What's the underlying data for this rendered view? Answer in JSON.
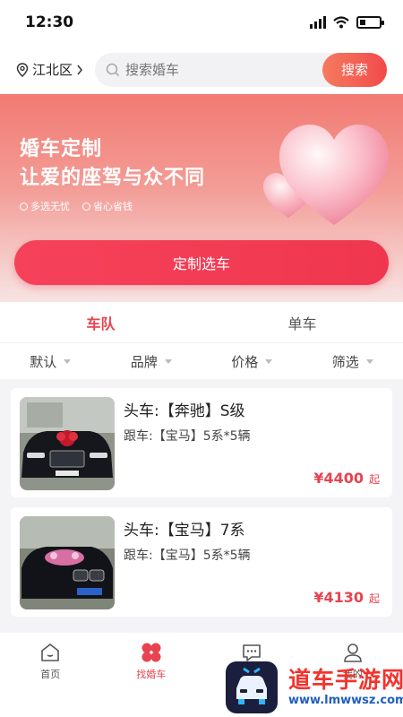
{
  "status_bar": {
    "time": "12:30"
  },
  "header": {
    "location": "江北区",
    "search_placeholder": "搜索婚车",
    "search_button": "搜索"
  },
  "banner": {
    "title_line1": "婚车定制",
    "title_line2": "让爱的座驾与众不同",
    "tags": [
      "多选无忧",
      "省心省钱"
    ],
    "cta_button": "定制选车"
  },
  "tabs": [
    {
      "label": "车队",
      "active": true
    },
    {
      "label": "单车",
      "active": false
    }
  ],
  "filters": [
    "默认",
    "品牌",
    "价格",
    "筛选"
  ],
  "cars": [
    {
      "lead": "头车:【奔驰】S级",
      "follow": "跟车:【宝马】5系*5辆",
      "price": "¥4400",
      "price_suffix": "起"
    },
    {
      "lead": "头车:【宝马】7系",
      "follow": "跟车:【宝马】5系*5辆",
      "price": "¥4130",
      "price_suffix": "起"
    }
  ],
  "bottom_nav": [
    {
      "label": "首页",
      "icon": "home-icon",
      "active": false
    },
    {
      "label": "找婚车",
      "icon": "clover-icon",
      "active": true
    },
    {
      "label": "",
      "icon": "message-icon",
      "active": false
    },
    {
      "label": "我的",
      "icon": "user-icon",
      "active": false
    }
  ],
  "watermark": {
    "title": "道车手游网",
    "url": "www.lmwwsz.com"
  },
  "colors": {
    "accent": "#e8434f",
    "button": "#f0364f",
    "banner": "#f27b73"
  }
}
